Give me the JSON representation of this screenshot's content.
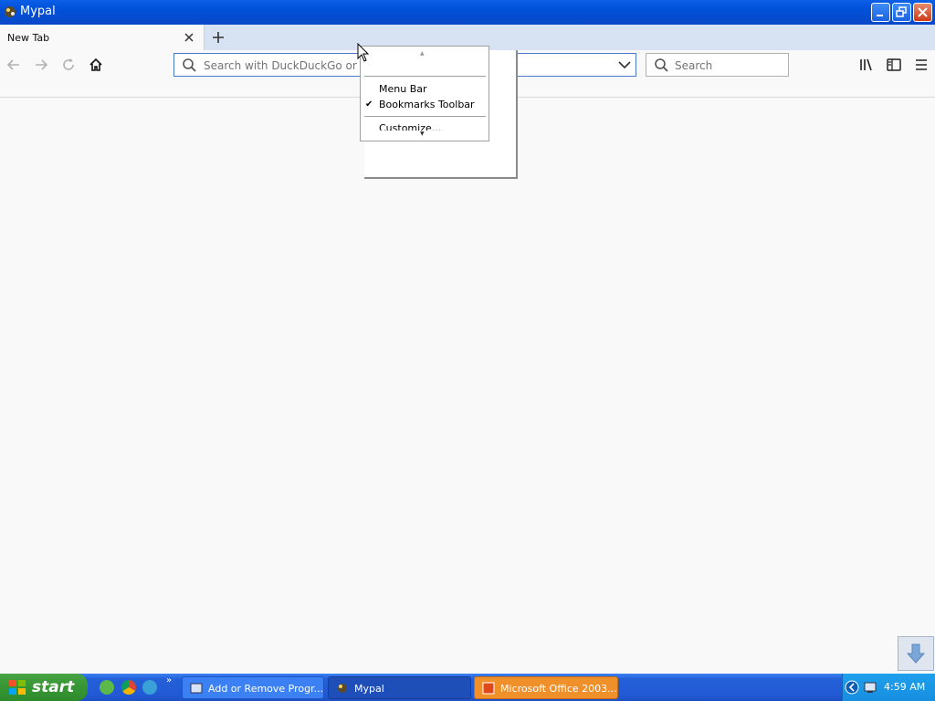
{
  "window": {
    "title": "Mypal",
    "icon": "mypal-icon",
    "controls": [
      "minimize-icon",
      "restore-icon",
      "close-icon"
    ]
  },
  "tabs": [
    {
      "label": "New Tab",
      "active": true
    }
  ],
  "navbar": {
    "urlbar_placeholder": "Search with DuckDuckGo or e",
    "search_placeholder": "Search"
  },
  "context_menu": {
    "items": [
      {
        "label": "Menu Bar",
        "checked": false
      },
      {
        "label": "Bookmarks Toolbar",
        "checked": true
      },
      {
        "label": "Customize...",
        "checked": false
      }
    ],
    "check_glyph": "✔"
  },
  "taskbar": {
    "start_label": "start",
    "buttons": [
      {
        "label": "Add or Remove Progr...",
        "state": "normal"
      },
      {
        "label": "Mypal",
        "state": "active"
      },
      {
        "label": "Microsoft Office 2003...",
        "state": "flashing"
      }
    ],
    "clock": "4:59 AM"
  },
  "colors": {
    "titlebar": "#0a5fe6",
    "taskbar": "#2459d4",
    "start": "#3c9a38",
    "flashing_button": "#f0902a"
  }
}
